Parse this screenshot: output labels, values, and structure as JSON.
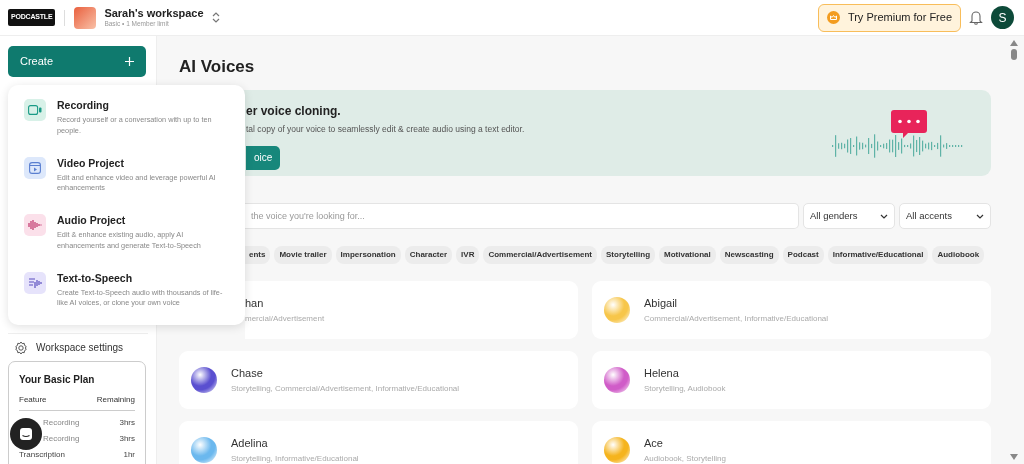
{
  "header": {
    "logo": "PODCASTLE",
    "workspace": {
      "name": "Sarah's workspace",
      "plan": "Basic • 1 Member limit"
    },
    "premium_button": "Try Premium for Free",
    "avatar_initial": "S"
  },
  "create_button": "Create",
  "create_menu": [
    {
      "kind": "recording",
      "title": "Recording",
      "description": "Record yourself or a conversation with up to ten people."
    },
    {
      "kind": "video",
      "title": "Video Project",
      "description": "Edit and enhance video and leverage powerful AI enhancements"
    },
    {
      "kind": "audio",
      "title": "Audio Project",
      "description": "Edit & enhance existing audio, apply AI enhancements and generate Text-to-Speech"
    },
    {
      "kind": "tts",
      "title": "Text-to-Speech",
      "description": "Create Text-to-Speech audio with thousands of life-like AI voices, or clone your own voice"
    }
  ],
  "sidebar": {
    "workspace_settings": "Workspace settings",
    "plan": {
      "title": "Your Basic Plan",
      "columns": [
        "Feature",
        "Remaining"
      ],
      "rows": [
        {
          "feature": "Recording",
          "remaining": "3hrs"
        },
        {
          "feature": "Recording",
          "remaining": "3hrs"
        },
        {
          "feature": "Transcription",
          "remaining": "1hr"
        }
      ]
    }
  },
  "main": {
    "title": "AI Voices",
    "banner": {
      "title": "er voice cloning.",
      "text": "tal copy of your voice to seamlessly edit & create audio using a text editor.",
      "button": "oice"
    },
    "search": {
      "placeholder": "the voice you're looking for..."
    },
    "filters": [
      "All genders",
      "All accents"
    ],
    "chips": [
      "ents",
      "Movie trailer",
      "Impersonation",
      "Character",
      "IVR",
      "Commercial/Advertisement",
      "Storytelling",
      "Motivational",
      "Newscasting",
      "Podcast",
      "Informative/Educational",
      "Audiobook"
    ],
    "voices": [
      {
        "name": "han",
        "tags": "mercial/Advertisement"
      },
      {
        "name": "Abigail",
        "tags": "Commercial/Advertisement, Informative/Educational",
        "color": "#f7c64a"
      },
      {
        "name": "Chase",
        "tags": "Storytelling, Commercial/Advertisement, Informative/Educational",
        "color": "#5a4fd0"
      },
      {
        "name": "Helena",
        "tags": "Storytelling, Audiobook",
        "color": "#d05cc8"
      },
      {
        "name": "Adelina",
        "tags": "Storytelling, Informative/Educational",
        "color": "#6bb8ee"
      },
      {
        "name": "Ace",
        "tags": "Audiobook, Storytelling",
        "color": "#f5b41e"
      }
    ]
  }
}
